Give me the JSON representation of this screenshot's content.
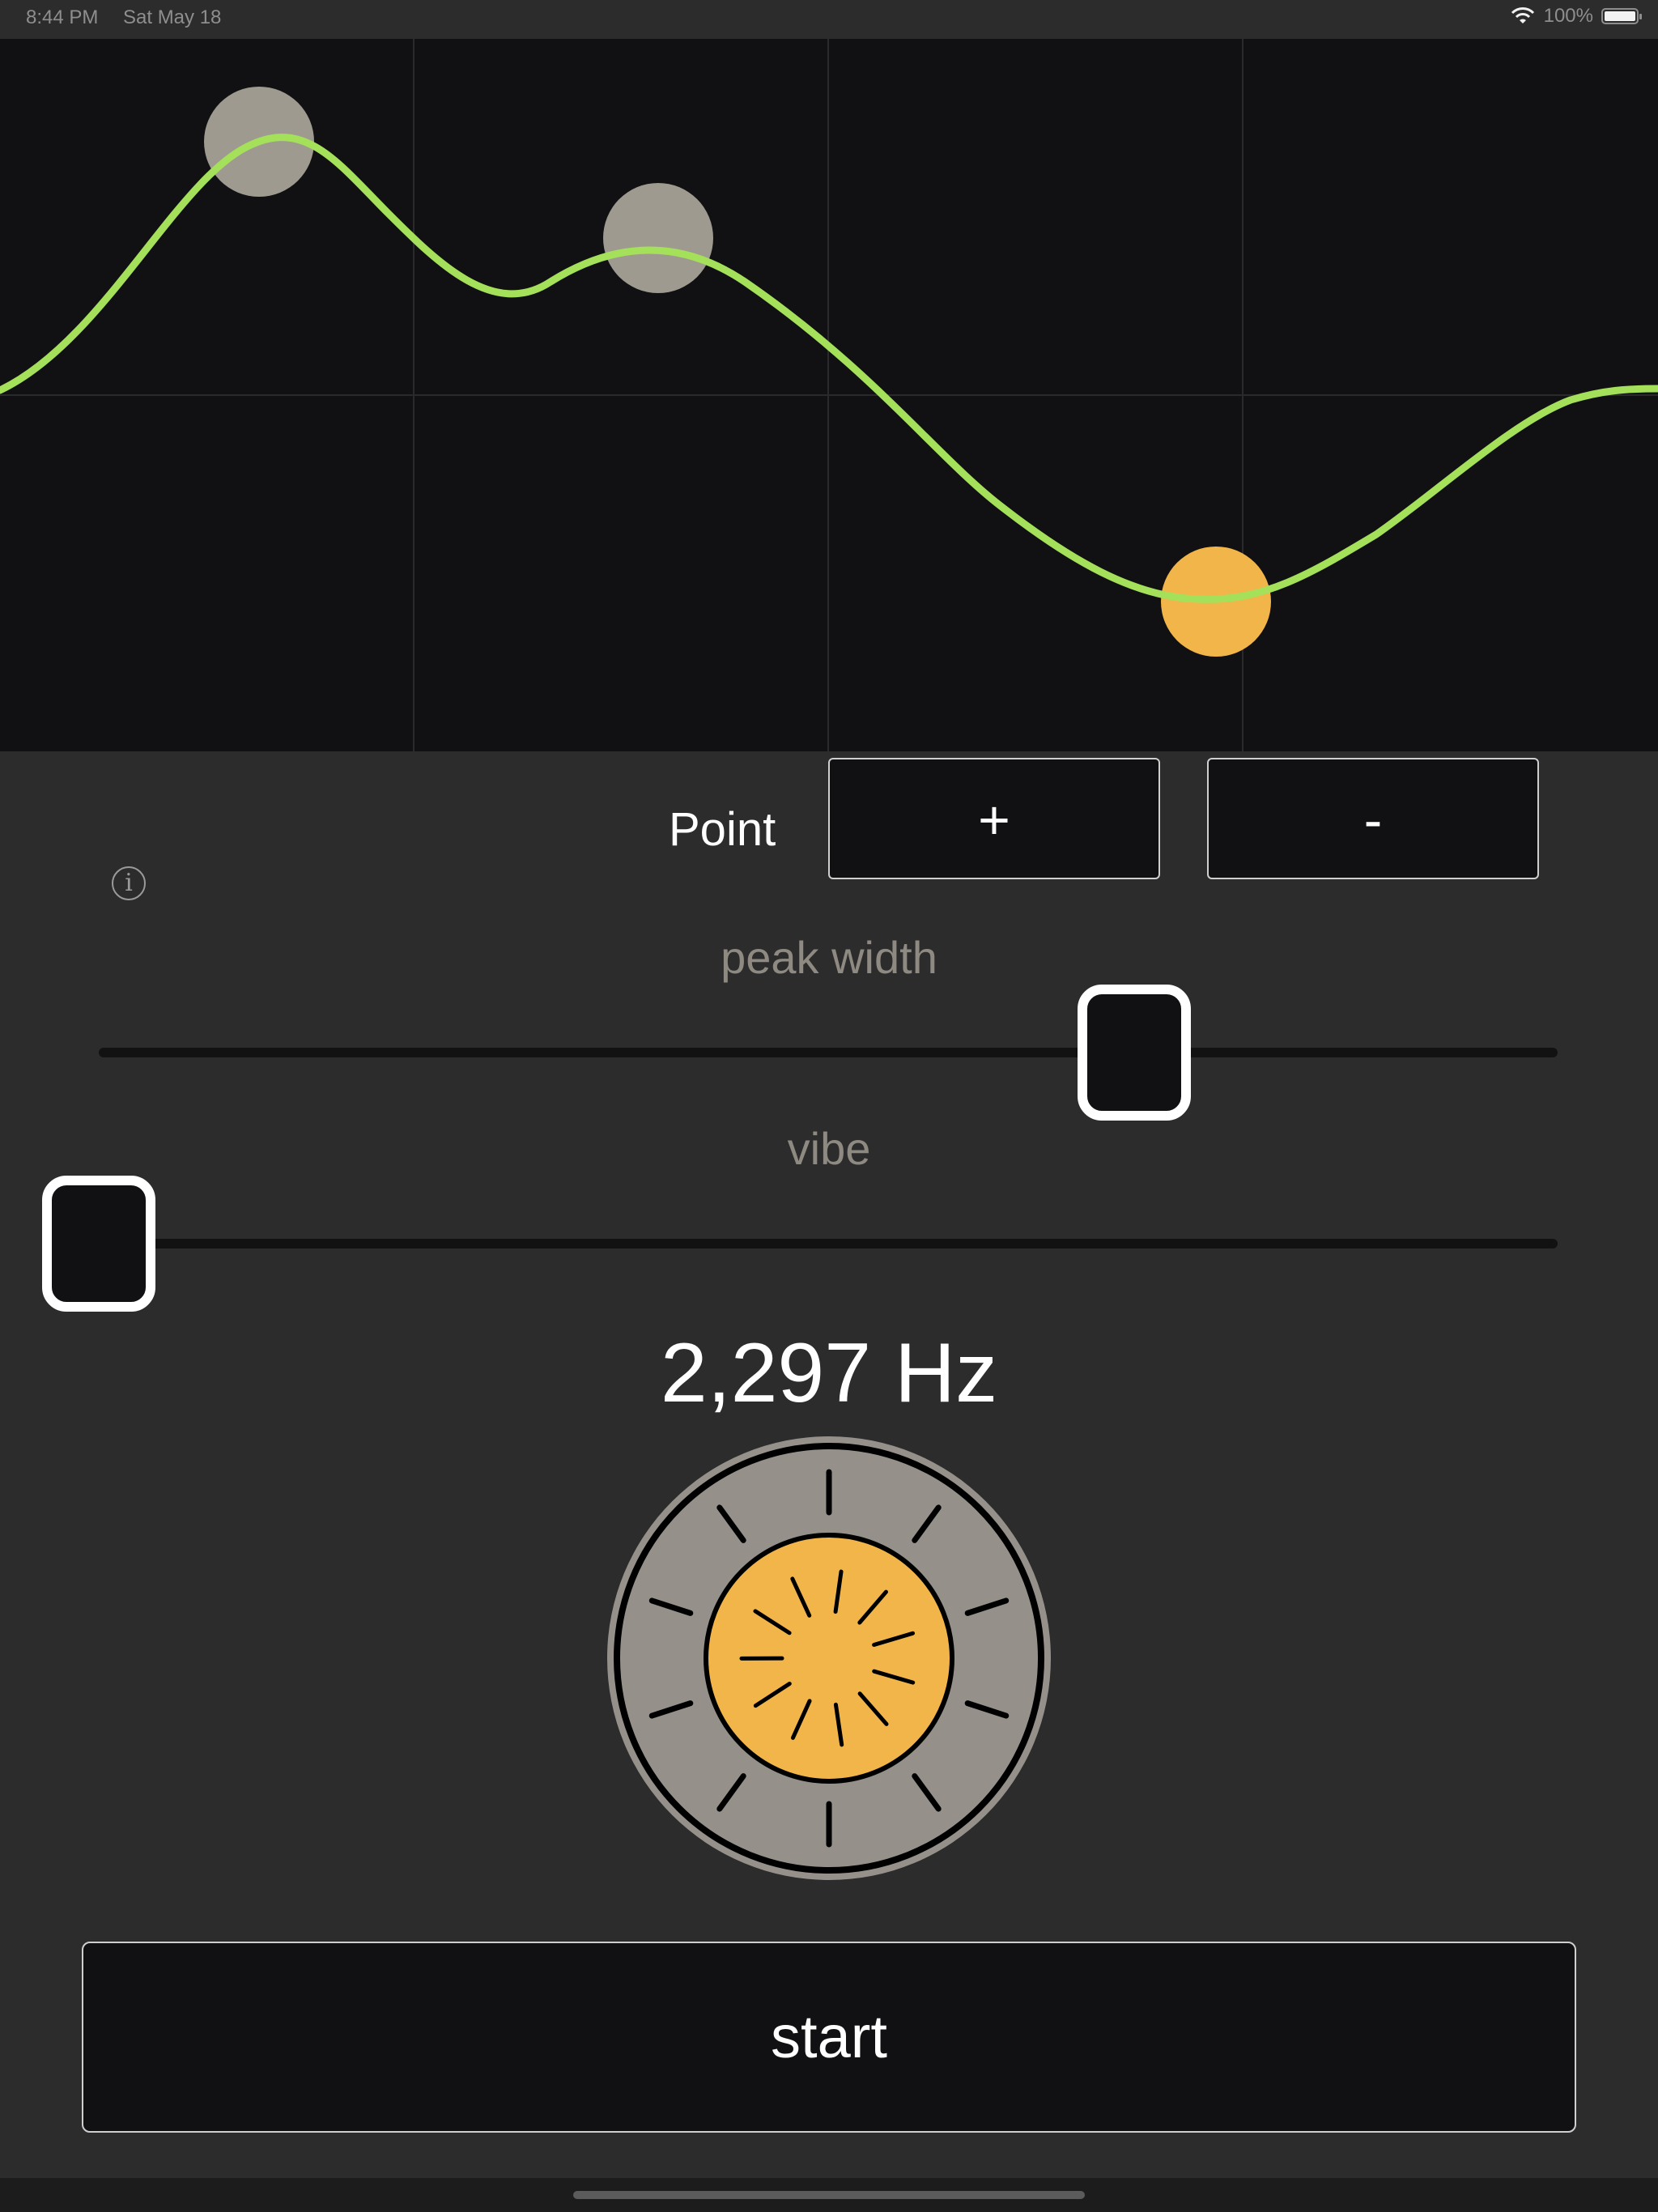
{
  "status_bar": {
    "time": "8:44 PM",
    "date": "Sat May 18",
    "battery_text": "100%",
    "battery_level": 1.0
  },
  "controls": {
    "point_label": "Point",
    "add_point_label": "+",
    "remove_point_label": "-",
    "info_icon": "info-icon"
  },
  "sliders": {
    "peak_width": {
      "label": "peak width",
      "value": 0.71
    },
    "vibe": {
      "label": "vibe",
      "value": 0.0
    }
  },
  "frequency_display": "2,297 Hz",
  "start_label": "start",
  "colors": {
    "curve": "#a4e05a",
    "point_inactive": "#9e9a90",
    "point_active": "#f2b54a",
    "dial_outer": "#95918a",
    "dial_inner": "#f2b54a"
  }
}
